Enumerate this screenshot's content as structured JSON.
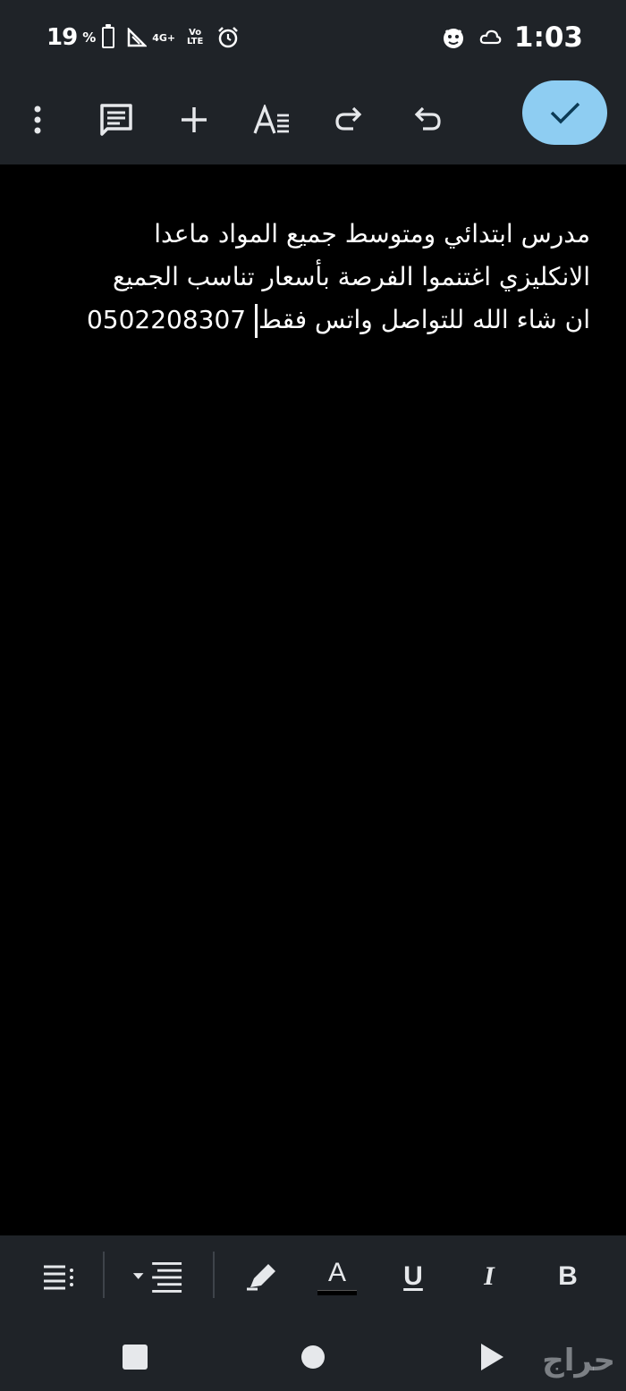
{
  "status_bar": {
    "battery": "19",
    "battery_unit": "%",
    "network": "4G+",
    "volte": "Vo LTE",
    "time": "1:03"
  },
  "toolbar": {
    "icons": [
      "more-vert-icon",
      "comment-icon",
      "insert-plus-icon",
      "text-format-icon",
      "redo-icon",
      "undo-icon",
      "confirm-check-icon"
    ]
  },
  "document": {
    "lines": [
      "مدرس ابتدائي ومتوسط جميع المواد ماعدا",
      "الانكليزي اغتنموا الفرصة بأسعار تناسب الجميع",
      "ان شاء الله  للتواصل واتس فقط"
    ],
    "phone": "0502208307"
  },
  "format_bar": {
    "text_color_letter": "A",
    "underline_letter": "U",
    "italic_letter": "I",
    "bold_letter": "B"
  },
  "watermark": "حراج",
  "colors": {
    "bar_bg": "#1f2328",
    "accent": "#8ecdf2",
    "canvas": "#000000"
  }
}
